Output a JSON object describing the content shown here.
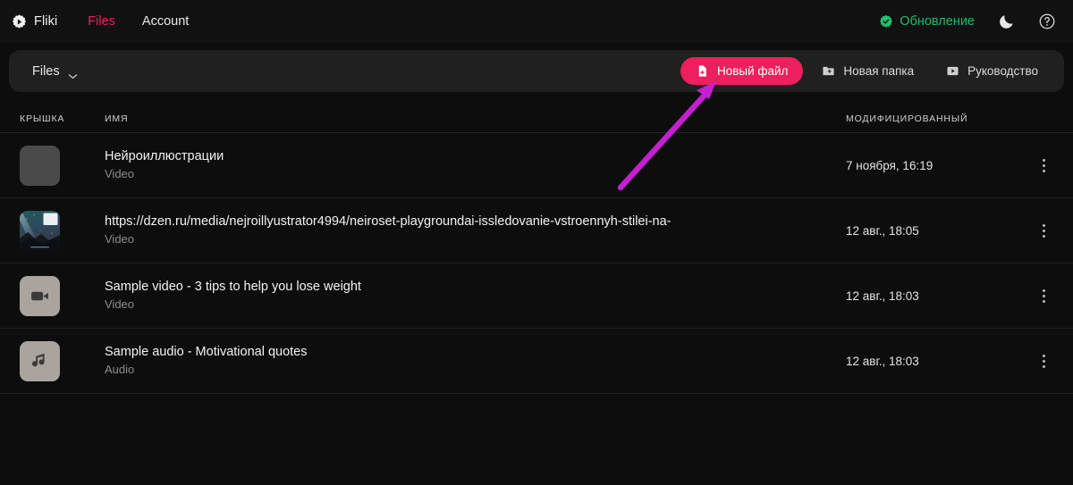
{
  "nav": {
    "brand": {
      "label": "Fliki",
      "icon": "fliki-play-badge-icon"
    },
    "links": [
      {
        "label": "Files",
        "active": true
      },
      {
        "label": "Account",
        "active": false
      }
    ],
    "update": {
      "label": "Обновление",
      "icon": "verified-badge-icon",
      "color": "#1fbf6f"
    },
    "theme_toggle_icon": "moon-icon",
    "help_icon": "question-circle-icon"
  },
  "toolbar": {
    "breadcrumb": "Files",
    "breadcrumb_chevron_icon": "chevron-down-icon",
    "new_file_label": "Новый файл",
    "new_file_icon": "file-add-icon",
    "new_file_color": "#ee1f5f",
    "new_folder_label": "Новая папка",
    "new_folder_icon": "folder-add-icon",
    "guide_label": "Руководство",
    "guide_icon": "video-play-icon"
  },
  "table": {
    "columns": {
      "cover": "КРЫШКА",
      "name": "ИМЯ",
      "modified": "МОДИФИЦИРОВАННЫЙ"
    },
    "rows": [
      {
        "title": "Нейроиллюстрации",
        "type": "Video",
        "modified": "7 ноября, 16:19",
        "thumb": "blank",
        "thumb_icon": ""
      },
      {
        "title": "https://dzen.ru/media/nejroillyustrator4994/neiroset-playgroundai-issledovanie-vstroennyh-stilei-na-",
        "type": "Video",
        "modified": "12 авг., 18:05",
        "thumb": "photo",
        "thumb_icon": "night-sky-thumbnail"
      },
      {
        "title": "Sample video - 3 tips to help you lose weight",
        "type": "Video",
        "modified": "12 авг., 18:03",
        "thumb": "media",
        "thumb_icon": "video-camera-icon"
      },
      {
        "title": "Sample audio - Motivational quotes",
        "type": "Audio",
        "modified": "12 авг., 18:03",
        "thumb": "media",
        "thumb_icon": "music-note-icon"
      }
    ],
    "row_menu_icon": "kebab-menu-icon"
  },
  "annotation": {
    "arrow_color": "#c41fd0",
    "points_to": "Новый файл"
  }
}
